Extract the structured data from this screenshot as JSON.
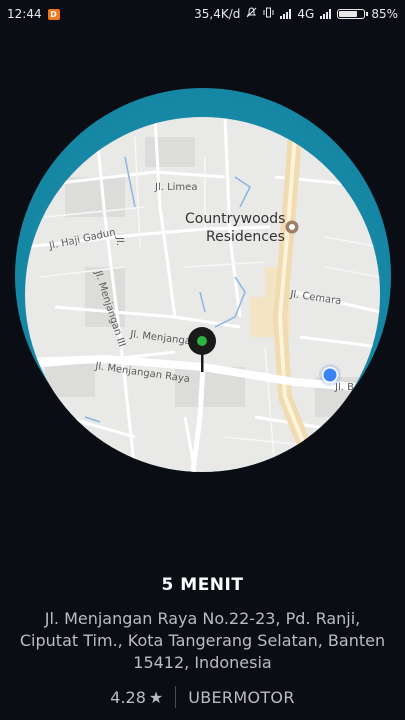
{
  "status_bar": {
    "time": "12:44",
    "network_speed": "35,4K/d",
    "network_type": "4G",
    "battery": "85%",
    "battery_level": 0.85
  },
  "map": {
    "streets": {
      "limea": "Jl. Limea",
      "haji_gadun": "Jl. Haji Gadun",
      "menjangan_iii": "Jl. Menjangan III",
      "menjangan_1": "Jl. Menjangan",
      "menjangan_raya": "Jl. Menjangan Raya",
      "cemara": "Jl. Cemara",
      "partial": "Jl. B",
      "small": "Jl."
    },
    "poi": {
      "line1": "Countrywoods",
      "line2": "Residences"
    },
    "colors": {
      "ring": "#1586a3",
      "pin_head": "#1a1a1a",
      "pin_dot": "#2fb344",
      "user_dot": "#3b82f6",
      "highway": "#f1dbb0"
    }
  },
  "trip": {
    "eta": "5 MENIT",
    "address_line1": "Jl. Menjangan Raya No.22-23, Pd. Ranji,",
    "address_line2": "Ciputat Tim., Kota Tangerang Selatan, Banten",
    "address_line3": "15412, Indonesia",
    "rating": "4.28",
    "star": "★",
    "vehicle_type": "UBERMOTOR"
  }
}
